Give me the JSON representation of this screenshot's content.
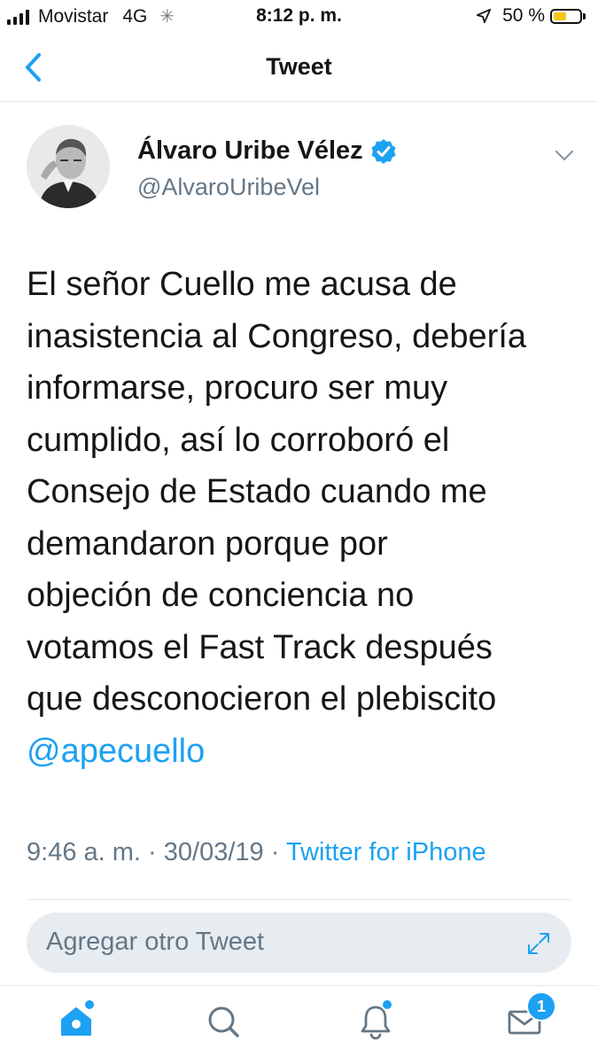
{
  "status_bar": {
    "carrier": "Movistar",
    "network": "4G",
    "time": "8:12 p. m.",
    "battery_text": "50 %",
    "battery_level": 0.5,
    "battery_color": "#f5c518"
  },
  "nav": {
    "title": "Tweet",
    "back_icon": "chevron-left-icon"
  },
  "tweet": {
    "author_name": "Álvaro Uribe Vélez",
    "handle": "@AlvaroUribeVel",
    "verified": true,
    "text_lines": [
      "El señor Cuello me acusa de",
      "inasistencia al Congreso, debería",
      "informarse, procuro ser muy",
      "cumplido, así lo corroboró el",
      "Consejo de Estado cuando me",
      "demandaron porque por",
      "objeción de conciencia no",
      "votamos el Fast Track después",
      "que desconocieron el plebiscito"
    ],
    "mention": "@apecuello",
    "time": "9:46 a. m.",
    "date": "30/03/19",
    "separator": "·",
    "source": "Twitter for iPhone"
  },
  "compose": {
    "placeholder": "Agregar otro Tweet"
  },
  "tabbar": {
    "items": [
      {
        "icon": "home-icon",
        "has_dot": true
      },
      {
        "icon": "search-icon",
        "has_dot": false
      },
      {
        "icon": "notifications-icon",
        "has_dot": true
      },
      {
        "icon": "messages-icon",
        "badge": "1"
      }
    ]
  },
  "colors": {
    "accent": "#1da1f2",
    "text": "#14171a",
    "secondary": "#657786",
    "divider": "#e1e8ed"
  }
}
